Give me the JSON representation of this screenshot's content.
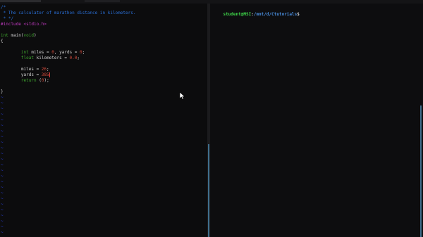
{
  "editor": {
    "lines": [
      {
        "segments": [
          {
            "cls": "c-com",
            "text": "/*"
          }
        ]
      },
      {
        "segments": [
          {
            "cls": "c-com",
            "text": " * The calculator of marathon distance in kilometers."
          }
        ]
      },
      {
        "segments": [
          {
            "cls": "c-com",
            "text": " * */"
          }
        ]
      },
      {
        "segments": [
          {
            "cls": "c-inc",
            "text": "#include <stdio.h>"
          }
        ]
      },
      {
        "segments": []
      },
      {
        "segments": [
          {
            "cls": "c-kw",
            "text": "int"
          },
          {
            "cls": "c-txt",
            "text": " main("
          },
          {
            "cls": "c-kw",
            "text": "void"
          },
          {
            "cls": "c-txt",
            "text": ")"
          }
        ]
      },
      {
        "segments": [
          {
            "cls": "c-txt",
            "text": "{"
          }
        ]
      },
      {
        "segments": []
      },
      {
        "segments": [
          {
            "cls": "c-txt",
            "text": "        "
          },
          {
            "cls": "c-kw",
            "text": "int"
          },
          {
            "cls": "c-txt",
            "text": " miles = "
          },
          {
            "cls": "c-num",
            "text": "0"
          },
          {
            "cls": "c-txt",
            "text": ", yards = "
          },
          {
            "cls": "c-num",
            "text": "0"
          },
          {
            "cls": "c-txt",
            "text": ";"
          }
        ]
      },
      {
        "segments": [
          {
            "cls": "c-txt",
            "text": "        "
          },
          {
            "cls": "c-kw",
            "text": "float"
          },
          {
            "cls": "c-txt",
            "text": " kilometers = "
          },
          {
            "cls": "c-num",
            "text": "0.0"
          },
          {
            "cls": "c-txt",
            "text": ";"
          }
        ]
      },
      {
        "segments": []
      },
      {
        "segments": [
          {
            "cls": "c-txt",
            "text": "        miles = "
          },
          {
            "cls": "c-num",
            "text": "26"
          },
          {
            "cls": "c-txt",
            "text": ";"
          }
        ]
      },
      {
        "segments": [
          {
            "cls": "c-txt",
            "text": "        yards = "
          },
          {
            "cls": "c-num",
            "text": "385"
          },
          {
            "cls": "cursor",
            "text": ""
          }
        ]
      },
      {
        "segments": [
          {
            "cls": "c-txt",
            "text": "        "
          },
          {
            "cls": "c-kw",
            "text": "return"
          },
          {
            "cls": "c-txt",
            "text": " ("
          },
          {
            "cls": "c-num",
            "text": "0"
          },
          {
            "cls": "c-txt",
            "text": ");"
          }
        ]
      },
      {
        "segments": []
      },
      {
        "segments": [
          {
            "cls": "c-txt",
            "text": "}"
          }
        ]
      }
    ],
    "tilde_char": "~",
    "tilde_count": 25
  },
  "terminal": {
    "user_host": "student@MSI",
    "separator": ":",
    "path": "/mnt/d/Ctutorials",
    "symbol": "$"
  },
  "colors": {
    "comment": "#2a6fd6",
    "include": "#c23bc2",
    "keyword": "#3fa52e",
    "number": "#d24a3a",
    "tilde": "#2a3fd6",
    "prompt_user": "#3fd64a",
    "prompt_path": "#4a8fe0",
    "active_border": "#3f6e8c"
  },
  "icons": {
    "mouse": "mouse-pointer-icon"
  }
}
